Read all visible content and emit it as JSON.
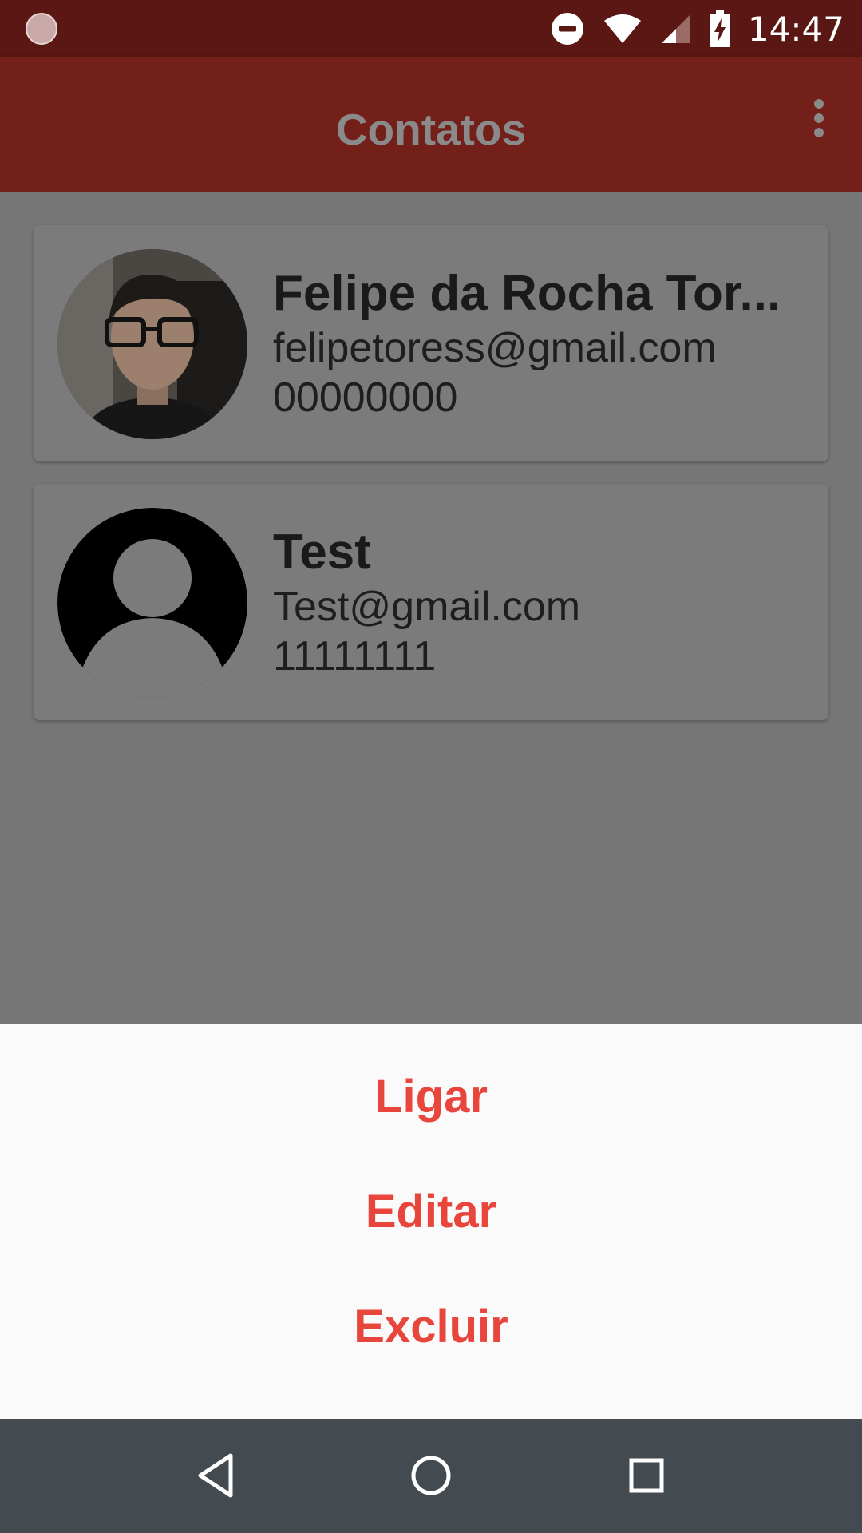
{
  "status_bar": {
    "time": "14:47",
    "icons": [
      "app-notification-icon",
      "do-not-disturb-icon",
      "wifi-icon",
      "cellular-signal-icon",
      "battery-charging-icon"
    ]
  },
  "app_bar": {
    "title": "Contatos",
    "menu_icon": "more-vert-icon"
  },
  "contacts": [
    {
      "name": "Felipe da Rocha Tor...",
      "email": "felipetoress@gmail.com",
      "phone": "00000000",
      "avatar": "photo"
    },
    {
      "name": "Test",
      "email": "Test@gmail.com",
      "phone": "11111111",
      "avatar": "default-person-icon"
    }
  ],
  "bottom_sheet": {
    "options": [
      "Ligar",
      "Editar",
      "Excluir"
    ],
    "text_color": "#e8453c"
  },
  "nav_bar": {
    "icons": [
      "back-icon",
      "home-icon",
      "recents-icon"
    ]
  },
  "colors": {
    "status_bar": "#5a1714",
    "app_bar": "#73201b",
    "scrim_background": "#767676",
    "sheet_background": "#fafafa",
    "nav_bar": "#434b51"
  }
}
